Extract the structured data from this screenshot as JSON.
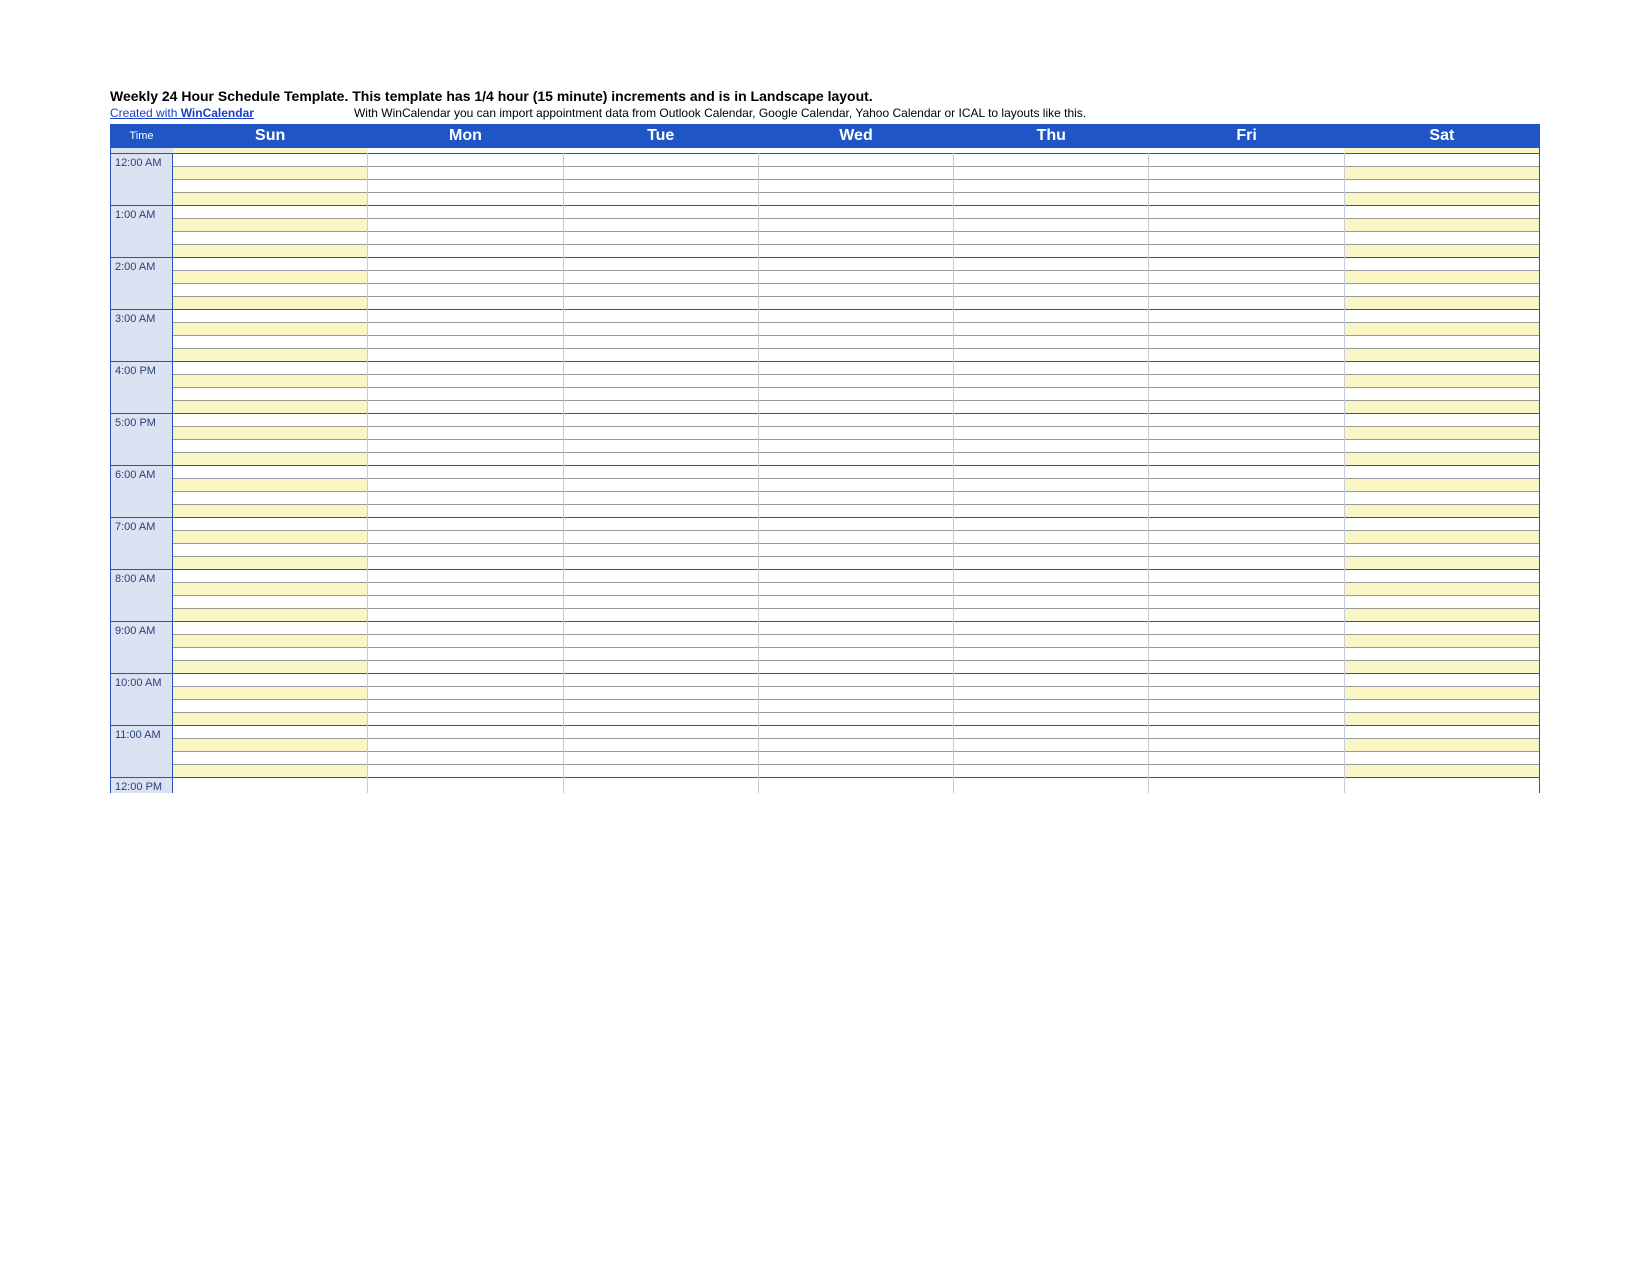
{
  "title": "Weekly 24 Hour Schedule Template.  This template has 1/4 hour (15 minute) increments and is in Landscape layout.",
  "created_with_prefix": "Created with ",
  "brand": "WinCalendar",
  "import_note": "With WinCalendar you can import appointment data from Outlook Calendar, Google Calendar, Yahoo Calendar or ICAL to layouts like this.",
  "header": {
    "time_label": "Time",
    "days": [
      "Sun",
      "Mon",
      "Tue",
      "Wed",
      "Thu",
      "Fri",
      "Sat"
    ]
  },
  "hours": [
    "12:00 AM",
    "1:00 AM",
    "2:00 AM",
    "3:00 AM",
    "4:00 PM",
    "5:00 PM",
    "6:00 AM",
    "7:00 AM",
    "8:00 AM",
    "9:00 AM",
    "10:00 AM",
    "11:00 AM"
  ],
  "cutoff_hour": "12:00 PM",
  "weekend_column_indices": [
    0,
    6
  ],
  "shaded_quarter_indices": [
    1,
    3
  ]
}
